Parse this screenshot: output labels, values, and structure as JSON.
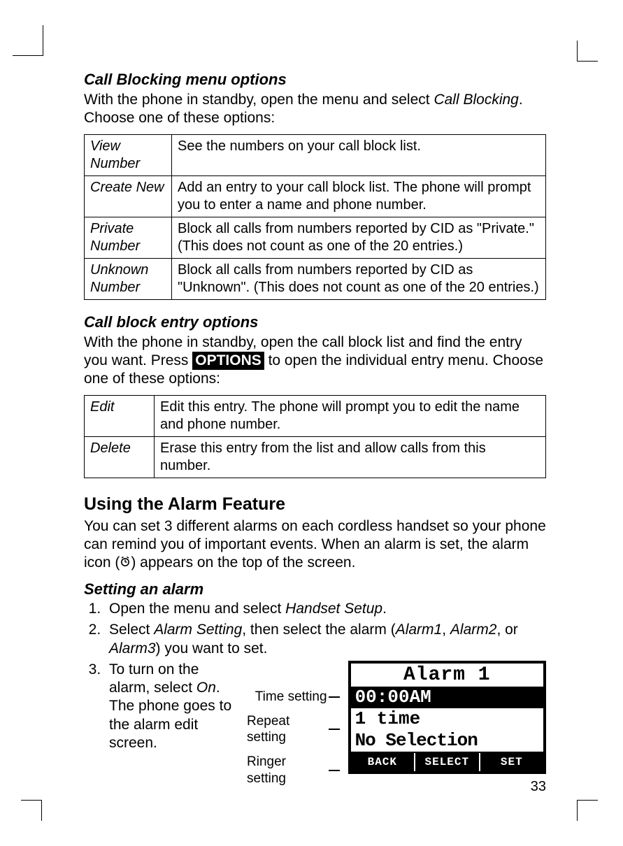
{
  "section1": {
    "heading": "Call Blocking menu options",
    "intro_a": "With the phone in standby, open the menu and select ",
    "intro_em": "Call Blocking",
    "intro_b": ". Choose one of these options:"
  },
  "table1": {
    "r1_label": "View Number",
    "r1_desc": "See the numbers on your call block list.",
    "r2_label": "Create New",
    "r2_desc": "Add an entry to your call block list. The phone will prompt you to enter a name and phone number.",
    "r3_label": "Private Number",
    "r3_desc": "Block all calls from numbers reported by CID as \"Private.\" (This does not count as one of the 20 entries.)",
    "r4_label": "Unknown Number",
    "r4_desc": "Block all calls from numbers reported by CID as \"Unknown\". (This does not count as one of the 20 entries.)"
  },
  "section2": {
    "heading": "Call block entry options",
    "intro_a": "With the phone in standby, open the call block list and find the entry you want. Press ",
    "btn": "OPTIONS",
    "intro_b": " to open the individual entry menu. Choose one of these options:"
  },
  "table2": {
    "r1_label": "Edit",
    "r1_desc": "Edit this entry. The phone will prompt you to edit the name and phone number.",
    "r2_label": "Delete",
    "r2_desc": "Erase this entry from the list and allow calls from this number."
  },
  "section3": {
    "heading": "Using the Alarm Feature",
    "intro_a": "You can set 3 different alarms on each cordless handset so your phone can remind you of important events. When an alarm is set, the alarm icon (",
    "intro_b": ") appears on the top of the screen."
  },
  "section4": {
    "heading": "Setting an alarm",
    "step1_a": "Open the menu and select ",
    "step1_em": "Handset Setup",
    "step1_b": ".",
    "step2_a": "Select ",
    "step2_em1": "Alarm Setting",
    "step2_b": ", then select the alarm (",
    "step2_em2": "Alarm1",
    "step2_c": ", ",
    "step2_em3": "Alarm2",
    "step2_d": ", or ",
    "step2_em4": "Alarm3",
    "step2_e": ") you want to set.",
    "step3_a": "To turn on the alarm, select ",
    "step3_em": "On",
    "step3_b": ". The phone goes to the alarm edit screen."
  },
  "lcd_labels": {
    "time": "Time setting",
    "repeat": "Repeat setting",
    "ringer": "Ringer setting"
  },
  "lcd": {
    "title": "Alarm 1",
    "time": "00:00AM",
    "repeat": "1 time",
    "ringer": "No Selection",
    "soft1": "BACK",
    "soft2": "SELECT",
    "soft3": "SET"
  },
  "page_number": "33"
}
